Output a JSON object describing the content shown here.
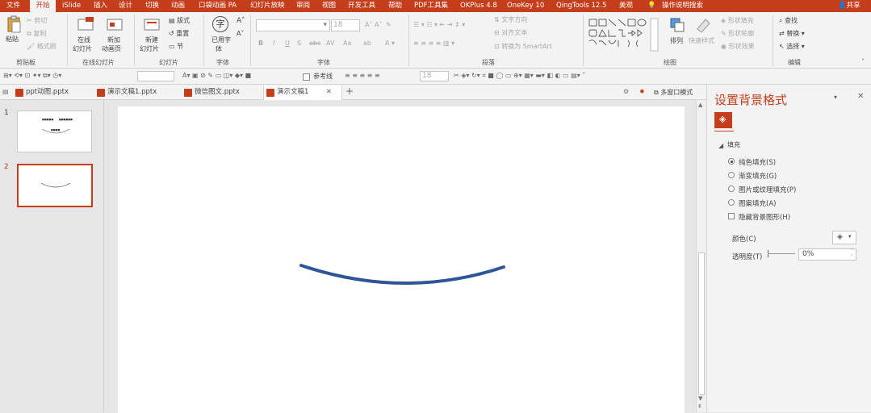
{
  "menubar": {
    "items": [
      "文件",
      "开始",
      "iSlide",
      "插入",
      "设计",
      "切换",
      "动画",
      "口袋动画 PA",
      "幻灯片放映",
      "审阅",
      "视图",
      "开发工具",
      "帮助",
      "PDF工具集",
      "OKPlus 4.8",
      "OneKey 10",
      "QingTools 12.5",
      "美观",
      "操作说明搜索"
    ],
    "active": "开始",
    "share_label": "共享"
  },
  "ribbon": {
    "clipboard": {
      "paste": "粘贴",
      "cut": "剪切",
      "copy": "复制",
      "format_painter": "格式刷",
      "label": "剪贴板"
    },
    "online_slides": {
      "online": "在线",
      "online2": "幻灯片",
      "new_anim": "新加",
      "new_anim2": "动画页",
      "label": "在线幻灯片"
    },
    "slides": {
      "new": "新建",
      "new2": "幻灯片",
      "layout": "版式",
      "reset": "重置",
      "section": "节",
      "label": "幻灯片"
    },
    "font_group": {
      "use_font": "已用字",
      "use_font2": "体",
      "label": "字体",
      "glyph": "字"
    },
    "font": {
      "size": "18",
      "label": "字体"
    },
    "paragraph": {
      "text_direction": "文字方向",
      "align_text": "对齐文本",
      "smartart": "转换为 SmartArt",
      "label": "段落"
    },
    "drawing": {
      "arrange": "排列",
      "quick_styles": "快速样式",
      "fill": "形状填充",
      "outline": "形状轮廓",
      "effect": "形状效果",
      "label": "绘图"
    },
    "editing": {
      "find": "查找",
      "replace": "替换",
      "select": "选择",
      "label": "编辑"
    }
  },
  "qat": {
    "gridlines_label": "参考线",
    "font_size": "18",
    "multi_window": "多窗口模式"
  },
  "doc_tabs": [
    "ppt动图.pptx",
    "演示文稿1.pptx",
    "微信图文.pptx",
    "演示文稿1"
  ],
  "active_tab": "演示文稿1",
  "thumbnails": [
    {
      "number": "1",
      "selected": false,
      "title_left": "■■■■■",
      "title_right": "■■■■■■",
      "subtitle": "■■■■"
    },
    {
      "number": "2",
      "selected": true
    }
  ],
  "format_pane": {
    "title": "设置背景格式",
    "section": "填充",
    "options": [
      {
        "label": "纯色填充(S)",
        "type": "radio",
        "checked": true
      },
      {
        "label": "渐变填充(G)",
        "type": "radio",
        "checked": false
      },
      {
        "label": "图片或纹理填充(P)",
        "type": "radio",
        "checked": false
      },
      {
        "label": "图案填充(A)",
        "type": "radio",
        "checked": false
      },
      {
        "label": "隐藏背景图形(H)",
        "type": "checkbox",
        "checked": false
      }
    ],
    "color_label": "颜色(C)",
    "transparency_label": "透明度(T)",
    "transparency_value": "0%"
  },
  "colors": {
    "accent": "#c43e1c",
    "curve": "#2e5597"
  }
}
